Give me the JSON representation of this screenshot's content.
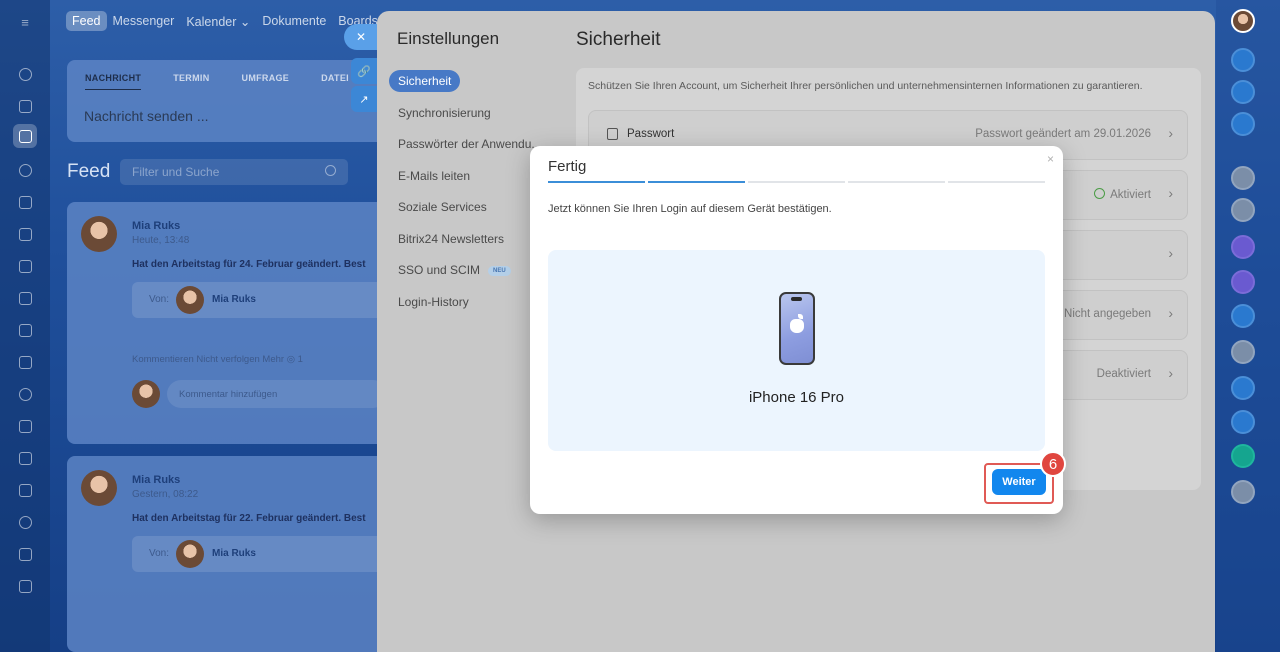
{
  "top_nav": {
    "items": [
      "Feed",
      "Messenger",
      "Kalender",
      "Dokumente",
      "Boards"
    ]
  },
  "composer": {
    "tabs": [
      "NACHRICHT",
      "TERMIN",
      "UMFRAGE",
      "DATEI"
    ],
    "placeholder": "Nachricht senden ..."
  },
  "feed": {
    "title": "Feed",
    "search_placeholder": "Filter und Suche",
    "posts": [
      {
        "author": "Mia Ruks",
        "time": "Heute, 13:48",
        "text": "Hat den Arbeitstag für 24. Februar geändert. Best",
        "von_label": "Von:",
        "von_name": "Mia Ruks",
        "actions": "Kommentieren   Nicht verfolgen   Mehr   ◎ 1",
        "comment_placeholder": "Kommentar hinzufügen"
      },
      {
        "author": "Mia Ruks",
        "time": "Gestern, 08:22",
        "text": "Hat den Arbeitstag für 22. Februar geändert. Best",
        "von_label": "Von:",
        "von_name": "Mia Ruks"
      }
    ]
  },
  "settings": {
    "title": "Einstellungen",
    "menu": [
      {
        "label": "Sicherheit",
        "active": true
      },
      {
        "label": "Synchronisierung"
      },
      {
        "label": "Passwörter der Anwendu..."
      },
      {
        "label": "E-Mails leiten"
      },
      {
        "label": "Soziale Services"
      },
      {
        "label": "Bitrix24 Newsletters"
      },
      {
        "label": "SSO und SCIM",
        "badge": "NEU"
      },
      {
        "label": "Login-History"
      }
    ]
  },
  "security": {
    "title": "Sicherheit",
    "description": "Schützen Sie Ihren Account, um Sicherheit Ihrer persönlichen und unternehmensinternen Informationen zu garantieren.",
    "rows": [
      {
        "label": "Passwort",
        "status": "Passwort geändert am 29.01.2026"
      },
      {
        "label": "",
        "status": "Aktiviert"
      },
      {
        "label": "",
        "status": ""
      },
      {
        "label": "",
        "status": "Nicht angegeben"
      },
      {
        "label": "",
        "status": "Deaktiviert"
      }
    ]
  },
  "modal": {
    "title": "Fertig",
    "close": "×",
    "progress_steps_done": 2,
    "progress_steps_total": 5,
    "text": "Jetzt können Sie Ihren Login auf diesem Gerät bestätigen.",
    "device_name": "iPhone 16 Pro",
    "next_button": "Weiter",
    "step_number": "6"
  },
  "colors": {
    "accent": "#1287ee",
    "highlight": "#e05a55",
    "progress": "#3b8ed8"
  }
}
